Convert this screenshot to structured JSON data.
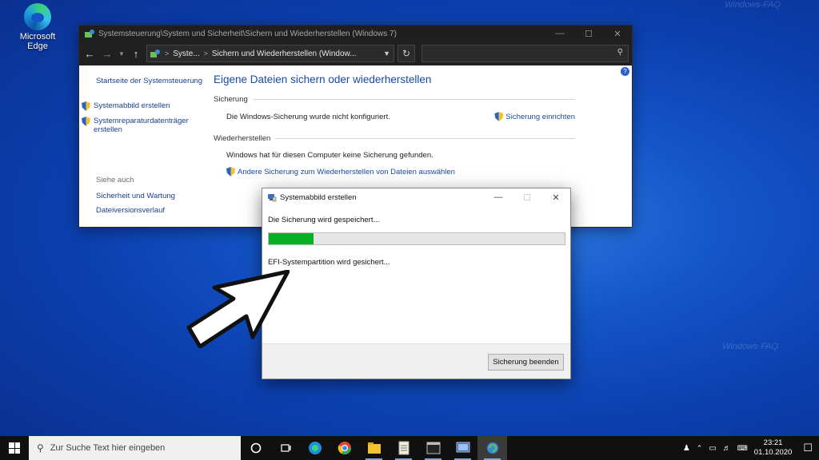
{
  "desktop": {
    "edge_label": "Microsoft Edge",
    "watermark": "Windows-FAQ"
  },
  "explorer": {
    "title": "Systemsteuerung\\System und Sicherheit\\Sichern und Wiederherstellen (Windows 7)",
    "address": {
      "crumb_1": "Syste...",
      "separator": ">",
      "crumb_2": "Sichern und Wiederherstellen (Window..."
    },
    "left_nav": {
      "home": "Startseite der Systemsteuerung",
      "create_image": "Systemabbild erstellen",
      "repair_disc": "Systemreparaturdatenträger erstellen",
      "see_also": "Siehe auch",
      "security_maintenance": "Sicherheit und Wartung",
      "file_history": "Dateiversionsverlauf"
    },
    "main": {
      "heading": "Eigene Dateien sichern oder wiederherstellen",
      "backup_section": "Sicherung",
      "backup_status": "Die Windows-Sicherung wurde nicht konfiguriert.",
      "setup_backup_link": "Sicherung einrichten",
      "restore_section": "Wiederherstellen",
      "restore_status": "Windows hat für diesen Computer keine Sicherung gefunden.",
      "other_backup_link": "Andere Sicherung zum Wiederherstellen von Dateien auswählen"
    }
  },
  "dialog": {
    "title": "Systemabbild erstellen",
    "status_saving": "Die Sicherung wird gespeichert...",
    "progress_fraction": 0.15,
    "status_step": "EFI-Systempartition wird gesichert...",
    "stop_button": "Sicherung beenden"
  },
  "taskbar": {
    "search_placeholder": "Zur Suche Text hier eingeben",
    "time": "23:21",
    "date": "01.10.2020"
  },
  "colors": {
    "progress_green": "#06b025",
    "link_blue": "#1a4aa1"
  }
}
